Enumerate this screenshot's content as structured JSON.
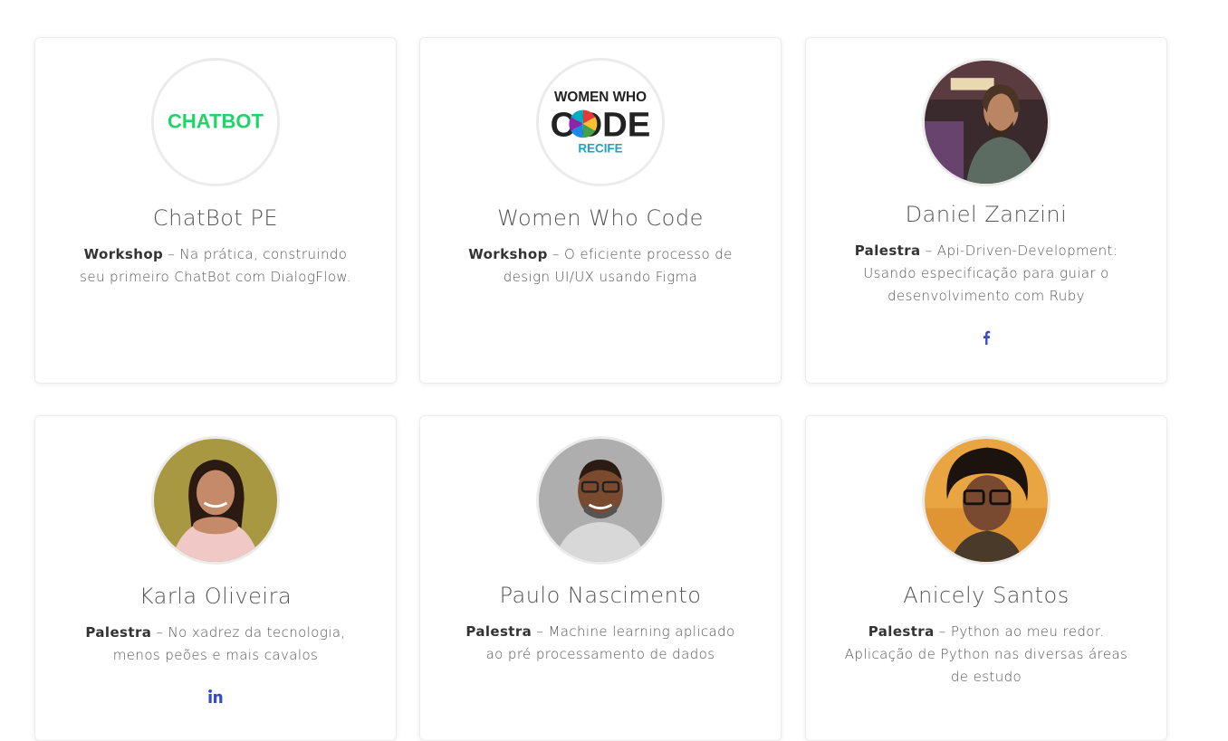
{
  "speakers": [
    {
      "name": "ChatBot PE",
      "type": "Workshop",
      "description": " – Na prática, construindo seu primeiro ChatBot com DialogFlow.",
      "logo_text": "CHATBOT"
    },
    {
      "name": "Women Who Code",
      "type": "Workshop",
      "description": " – O eficiente processo de design UI/UX usando Figma",
      "logo_text": {
        "top": "WOMEN WHO",
        "middle": "CODE",
        "bottom": "RECIFE"
      }
    },
    {
      "name": "Daniel Zanzini",
      "type": "Palestra",
      "description": " – Api-Driven-Development: Usando especificação para guiar o desenvolvimento com Ruby",
      "social": "facebook-icon"
    },
    {
      "name": "Karla Oliveira",
      "type": "Palestra",
      "description": " – No xadrez da tecnologia, menos peões e mais cavalos",
      "social": "linkedin-icon"
    },
    {
      "name": "Paulo Nascimento",
      "type": "Palestra",
      "description": " – Machine learning aplicado ao pré processamento de dados"
    },
    {
      "name": "Anicely Santos",
      "type": "Palestra",
      "description": " – Python ao meu redor. Aplicação de Python nas diversas áreas de estudo"
    }
  ],
  "colors": {
    "chatbot_green": "#22d36a",
    "social_blue": "#3b4cc0",
    "card_border": "#ececec"
  }
}
